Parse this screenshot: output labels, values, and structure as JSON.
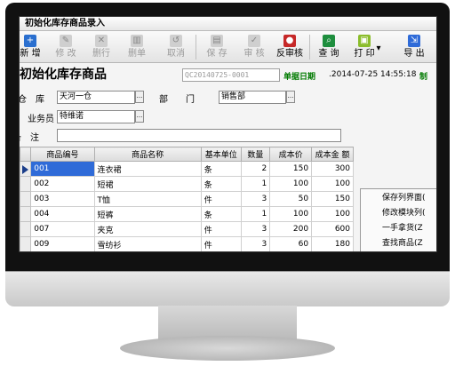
{
  "window": {
    "title": "初始化库存商品录入"
  },
  "toolbar": {
    "new": "新 增",
    "edit": "修 改",
    "delete_row": "删行",
    "delete_doc": "删单",
    "cancel": "取消",
    "save": "保 存",
    "audit": "审 核",
    "unaudit": "反审核",
    "query": "查 询",
    "print": "打 印",
    "print_dropdown": "▾",
    "export": "导 出"
  },
  "header": {
    "title": "初始化库存商品",
    "doc_no": "QC20140725-0001",
    "date_label": "单据日期",
    "date_value": ".2014-07-25 14:55:18",
    "maker_label": "制"
  },
  "form": {
    "warehouse_label": "仓　库",
    "warehouse_value": "天河一仓",
    "dept_label": "部　　门",
    "dept_value": "销售部",
    "clerk_label": "业务员",
    "clerk_value": "特维诺",
    "memo_label": "备　注",
    "memo_value": "",
    "lookup_button": "..."
  },
  "grid": {
    "columns": [
      "商品编号",
      "商品名称",
      "基本单位",
      "数量",
      "成本价",
      "成本金 额"
    ],
    "rows": [
      [
        "001",
        "连衣裙",
        "条",
        "2",
        "150",
        "300"
      ],
      [
        "002",
        "短裙",
        "条",
        "1",
        "100",
        "100"
      ],
      [
        "003",
        "T恤",
        "件",
        "3",
        "50",
        "150"
      ],
      [
        "004",
        "短裤",
        "条",
        "1",
        "100",
        "100"
      ],
      [
        "007",
        "夹克",
        "件",
        "3",
        "200",
        "600"
      ],
      [
        "009",
        "雪纺衫",
        "件",
        "3",
        "60",
        "180"
      ]
    ]
  },
  "context_menu": {
    "items": [
      "保存列界面(",
      "修改模块列(",
      "一手拿货(Z",
      "查找商品(Z"
    ]
  },
  "colors": {
    "accent": "#2f6bd8",
    "green_label": "#007a00"
  }
}
